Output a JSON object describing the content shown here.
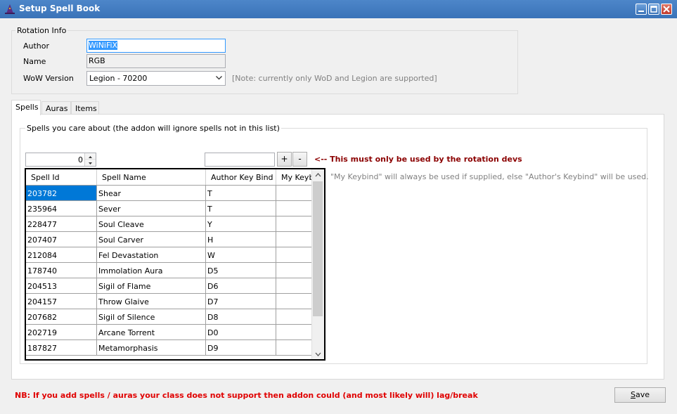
{
  "window": {
    "title": "Setup Spell Book"
  },
  "rotation_info": {
    "group_title": "Rotation Info",
    "author_label": "Author",
    "author_value": "WiNiFiX",
    "name_label": "Name",
    "name_value": "RGB",
    "wow_version_label": "WoW Version",
    "wow_version_value": "Legion - 70200",
    "note": "[Note: currently only WoD and Legion are supported]"
  },
  "tabs": [
    {
      "label": "Spells",
      "active": true
    },
    {
      "label": "Auras",
      "active": false
    },
    {
      "label": "Items",
      "active": false
    }
  ],
  "spells_tab": {
    "group_title": "Spells you care about (the addon will ignore spells not in this list)",
    "numeric_value": "0",
    "spell_input_value": "",
    "add_label": "+",
    "remove_label": "-",
    "dev_note": "<-- This must only be used by the rotation devs",
    "keybind_note": "\"My Keybind\" will always be used if supplied, else \"Author's Keybind\" will be used."
  },
  "grid": {
    "columns": [
      "Spell Id",
      "Spell Name",
      "Author Key Bind",
      "My Keybind"
    ],
    "rows": [
      [
        "203782",
        "Shear",
        "T",
        ""
      ],
      [
        "235964",
        "Sever",
        "T",
        ""
      ],
      [
        "228477",
        "Soul Cleave",
        "Y",
        ""
      ],
      [
        "207407",
        "Soul Carver",
        "H",
        ""
      ],
      [
        "212084",
        "Fel Devastation",
        "W",
        ""
      ],
      [
        "178740",
        "Immolation Aura",
        "D5",
        ""
      ],
      [
        "204513",
        "Sigil of Flame",
        "D6",
        ""
      ],
      [
        "204157",
        "Throw Glaive",
        "D7",
        ""
      ],
      [
        "207682",
        "Sigil of Silence",
        "D8",
        ""
      ],
      [
        "202719",
        "Arcane Torrent",
        "D0",
        ""
      ],
      [
        "187827",
        "Metamorphasis",
        "D9",
        ""
      ]
    ]
  },
  "footer": {
    "nb_note": "NB: If you add spells / auras your class does not support then addon could (and most likely will) lag/break",
    "save_label_underlined": "S",
    "save_label_rest": "ave"
  },
  "colors": {
    "titlebar": "#3a73b8",
    "dev_note": "#8b0000",
    "nb_note": "#e00000",
    "selection": "#0078d7"
  }
}
